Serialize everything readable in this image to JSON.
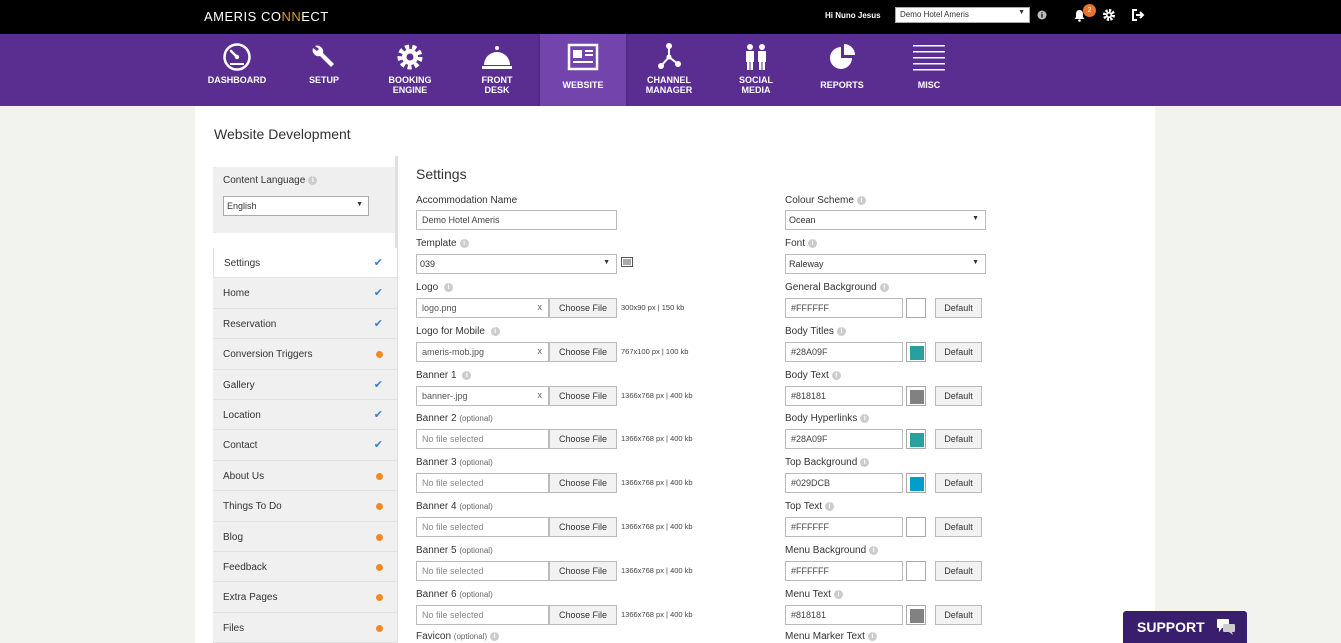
{
  "topbar": {
    "brand_left": "AMERIS CO",
    "brand_accent": "NN",
    "brand_right": "ECT",
    "greeting": "Hi Nuno Jesus",
    "hotel": "Demo Hotel Ameris",
    "notification_count": "2"
  },
  "nav": [
    {
      "label": "DASHBOARD",
      "icon": "dashboard-gauge"
    },
    {
      "label": "SETUP",
      "icon": "wrench"
    },
    {
      "label": "BOOKING\nENGINE",
      "icon": "gear"
    },
    {
      "label": "FRONT\nDESK",
      "icon": "service-bell"
    },
    {
      "label": "WEBSITE",
      "icon": "webpage",
      "active": true
    },
    {
      "label": "CHANNEL\nMANAGER",
      "icon": "network"
    },
    {
      "label": "SOCIAL\nMEDIA",
      "icon": "people"
    },
    {
      "label": "REPORTS",
      "icon": "pie-chart"
    },
    {
      "label": "MISC",
      "icon": "list-lines"
    }
  ],
  "page_title": "Website Development",
  "content_language": {
    "label": "Content Language",
    "value": "English"
  },
  "menu": [
    {
      "label": "Settings",
      "status": "done"
    },
    {
      "label": "Home",
      "status": "done"
    },
    {
      "label": "Reservation",
      "status": "done"
    },
    {
      "label": "Conversion Triggers",
      "status": "pending"
    },
    {
      "label": "Gallery",
      "status": "done"
    },
    {
      "label": "Location",
      "status": "done"
    },
    {
      "label": "Contact",
      "status": "done"
    },
    {
      "label": "About Us",
      "status": "pending"
    },
    {
      "label": "Things To Do",
      "status": "pending"
    },
    {
      "label": "Blog",
      "status": "pending"
    },
    {
      "label": "Feedback",
      "status": "pending"
    },
    {
      "label": "Extra Pages",
      "status": "pending"
    },
    {
      "label": "Files",
      "status": "pending"
    }
  ],
  "settings": {
    "title": "Settings",
    "accommodation_name": {
      "label": "Accommodation Name",
      "value": "Demo Hotel Ameris"
    },
    "template": {
      "label": "Template",
      "value": "039"
    },
    "files": [
      {
        "label": "Logo",
        "optional": "",
        "value": "logo.png",
        "hint": "300x90 px | 150 kb",
        "clearable": true
      },
      {
        "label": "Logo for Mobile",
        "optional": "",
        "value": "ameris-mob.jpg",
        "hint": "767x100 px | 100 kb",
        "clearable": true
      },
      {
        "label": "Banner 1",
        "optional": "",
        "value": "banner-.jpg",
        "hint": "1366x768 px | 400 kb",
        "clearable": true
      },
      {
        "label": "Banner 2",
        "optional": "(optional)",
        "value": "No file selected",
        "hint": "1366x768 px | 400 kb",
        "clearable": false
      },
      {
        "label": "Banner 3",
        "optional": "(optional)",
        "value": "No file selected",
        "hint": "1366x768 px | 400 kb",
        "clearable": false
      },
      {
        "label": "Banner 4",
        "optional": "(optional)",
        "value": "No file selected",
        "hint": "1366x768 px | 400 kb",
        "clearable": false
      },
      {
        "label": "Banner 5",
        "optional": "(optional)",
        "value": "No file selected",
        "hint": "1366x768 px | 400 kb",
        "clearable": false
      },
      {
        "label": "Banner 6",
        "optional": "(optional)",
        "value": "No file selected",
        "hint": "1366x768 px | 400 kb",
        "clearable": false
      }
    ],
    "favicon": {
      "label": "Favicon",
      "optional": "(optional)"
    },
    "choose_file_label": "Choose File",
    "clear_symbol": "x",
    "colour_scheme": {
      "label": "Colour Scheme",
      "value": "Ocean"
    },
    "font": {
      "label": "Font",
      "value": "Raleway"
    },
    "colors": [
      {
        "label": "General Background",
        "value": "#FFFFFF",
        "swatch": "#FFFFFF"
      },
      {
        "label": "Body Titles",
        "value": "#28A09F",
        "swatch": "#28A09F"
      },
      {
        "label": "Body Text",
        "value": "#818181",
        "swatch": "#818181"
      },
      {
        "label": "Body Hyperlinks",
        "value": "#28A09F",
        "swatch": "#28A09F"
      },
      {
        "label": "Top Background",
        "value": "#029DCB",
        "swatch": "#029DCB"
      },
      {
        "label": "Top Text",
        "value": "#FFFFFF",
        "swatch": "#FFFFFF"
      },
      {
        "label": "Menu Background",
        "value": "#FFFFFF",
        "swatch": "#FFFFFF"
      },
      {
        "label": "Menu Text",
        "value": "#818181",
        "swatch": "#818181"
      }
    ],
    "menu_marker_text": {
      "label": "Menu Marker Text"
    },
    "default_label": "Default"
  },
  "support": {
    "label": "SUPPORT"
  },
  "theme": {
    "purple": "#5a2d91",
    "purple_active": "#7244ac",
    "check": "#3d7fd0",
    "pending": "#f08a24"
  }
}
